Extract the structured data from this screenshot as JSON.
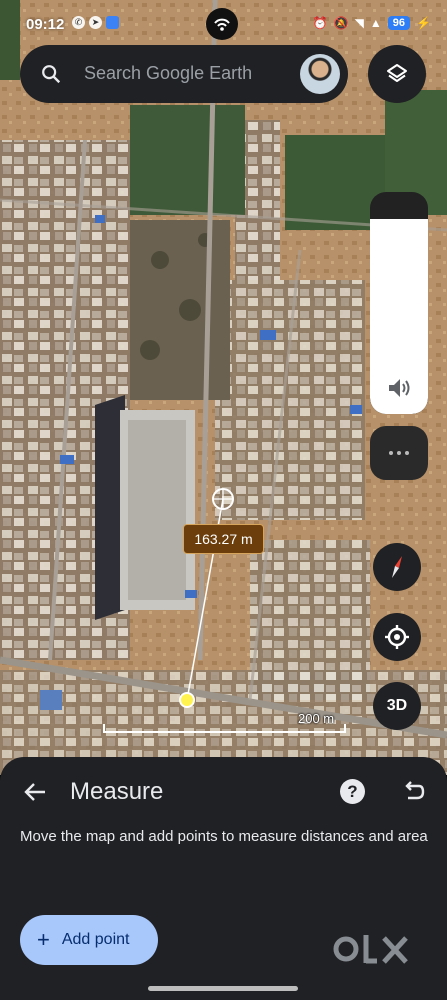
{
  "status_bar": {
    "time": "09:12",
    "battery": "96",
    "left_icons": [
      "whatsapp-icon",
      "telegram-icon",
      "app-icon"
    ],
    "right_icons": [
      "alarm-icon",
      "mute-icon",
      "wifi-icon",
      "signal-icon",
      "charging-icon"
    ]
  },
  "search": {
    "placeholder": "Search Google Earth"
  },
  "map": {
    "distance_label": "163.27 m",
    "scale_label": "200 m"
  },
  "controls": {
    "volume_level": 0.88,
    "three_d_label": "3D"
  },
  "measure_sheet": {
    "title": "Measure",
    "description": "Move the map and add points to measure distances and area",
    "add_point_label": "Add point",
    "add_point_icon": "+"
  },
  "watermark": {
    "text": "OLX"
  },
  "colors": {
    "distance_label_bg": "#6b3e0c",
    "add_point_bg": "#a8c7fa",
    "sheet_bg": "#202124",
    "battery_bg": "#2d7df6"
  }
}
